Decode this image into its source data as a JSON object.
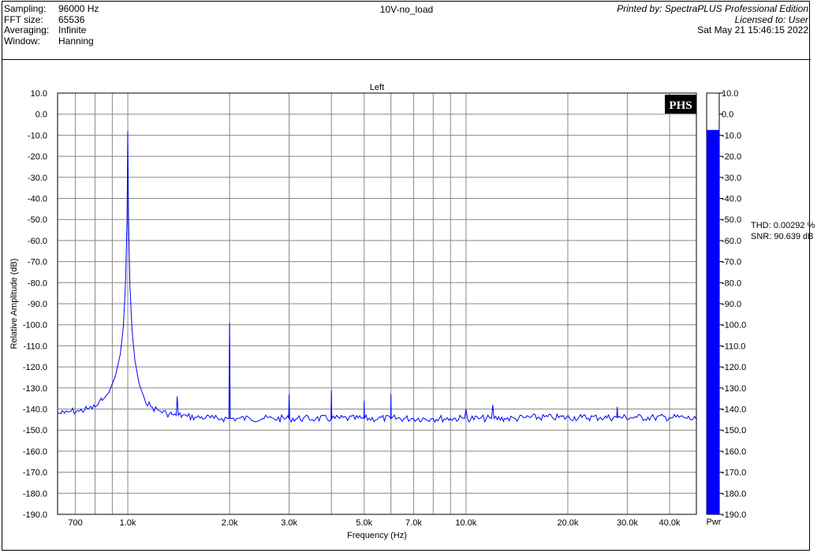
{
  "header": {
    "rows": [
      {
        "label": "Sampling:",
        "value": "96000 Hz"
      },
      {
        "label": "FFT size:",
        "value": "65536"
      },
      {
        "label": "Averaging:",
        "value": "Infinite"
      },
      {
        "label": "Window:",
        "value": "Hanning"
      }
    ],
    "title": "10V-no_load",
    "printed_by": "Printed by: SpectraPLUS Professional Edition",
    "licensed_to": "Licensed to: User",
    "date": "Sat May 21 15:46:15 2022"
  },
  "stats": {
    "thd": "THD: 0.00292 %",
    "snr": "SNR: 90.639 dB"
  },
  "logo": "PHS",
  "power_bar": {
    "label": "Pwr",
    "level_db": -7.5,
    "fill_color": "#0000ff"
  },
  "chart_data": {
    "type": "line",
    "title": "Left",
    "xlabel": "Frequency (Hz)",
    "ylabel": "Relative Amplitude (dB)",
    "x_scale": "log",
    "xlim": [
      620,
      48000
    ],
    "ylim": [
      -190,
      10
    ],
    "grid": true,
    "line_color": "#0000ff",
    "x_ticks": [
      {
        "v": 700,
        "label": "700"
      },
      {
        "v": 1000,
        "label": "1.0k"
      },
      {
        "v": 2000,
        "label": "2.0k"
      },
      {
        "v": 3000,
        "label": "3.0k"
      },
      {
        "v": 5000,
        "label": "5.0k"
      },
      {
        "v": 7000,
        "label": "7.0k"
      },
      {
        "v": 10000,
        "label": "10.0k"
      },
      {
        "v": 20000,
        "label": "20.0k"
      },
      {
        "v": 30000,
        "label": "30.0k"
      },
      {
        "v": 40000,
        "label": "40.0k"
      }
    ],
    "x_grid": [
      700,
      800,
      900,
      1000,
      2000,
      3000,
      4000,
      5000,
      6000,
      7000,
      8000,
      9000,
      10000,
      20000,
      30000,
      40000
    ],
    "y_ticks": [
      10,
      0,
      -10,
      -20,
      -30,
      -40,
      -50,
      -60,
      -70,
      -80,
      -90,
      -100,
      -110,
      -120,
      -130,
      -140,
      -150,
      -160,
      -170,
      -180,
      -190
    ],
    "y_tick_labels": [
      "10.0",
      "0.0",
      "-10.0",
      "-20.0",
      "-30.0",
      "-40.0",
      "-50.0",
      "-60.0",
      "-70.0",
      "-80.0",
      "-90.0",
      "-100.0",
      "-110.0",
      "-120.0",
      "-130.0",
      "-140.0",
      "-150.0",
      "-160.0",
      "-170.0",
      "-180.0",
      "-190.0"
    ],
    "series": [
      {
        "x": [
          620,
          650,
          680,
          720,
          760,
          800,
          840,
          880,
          920,
          950,
          970,
          985,
          995,
          1000,
          1005,
          1015,
          1030,
          1050,
          1080,
          1120,
          1170,
          1250,
          1300,
          1350,
          1390,
          1400,
          1410,
          1450,
          1500,
          1600,
          1700,
          1800,
          1900,
          1990,
          2000,
          2010,
          2100,
          2300,
          2500,
          2700,
          2990,
          3000,
          3010,
          3300,
          3600,
          3990,
          4000,
          4010,
          4500,
          4990,
          5000,
          5010,
          5500,
          5990,
          6000,
          6010,
          7000,
          8000,
          9000,
          9900,
          10000,
          10100,
          11000,
          11900,
          12000,
          12100,
          13000,
          14000,
          15000,
          18000,
          22000,
          25000,
          27900,
          28000,
          28100,
          32000,
          36000,
          40000,
          44000,
          48000
        ],
        "y": [
          -142,
          -142,
          -141,
          -141,
          -140,
          -139,
          -136,
          -132,
          -124,
          -114,
          -101,
          -80,
          -50,
          -8,
          -50,
          -82,
          -103,
          -117,
          -128,
          -135,
          -139,
          -141,
          -142,
          -142.5,
          -143,
          -134,
          -143,
          -143,
          -143.5,
          -144,
          -144,
          -144.5,
          -144.5,
          -144.5,
          -99,
          -144.5,
          -144.5,
          -144.5,
          -144.5,
          -144.5,
          -144.5,
          -133,
          -144.5,
          -144.5,
          -144.5,
          -144.5,
          -131,
          -144.5,
          -144.5,
          -144.5,
          -136,
          -144.5,
          -144.5,
          -144.5,
          -133,
          -144.5,
          -144.5,
          -144.5,
          -144.5,
          -144.5,
          -140,
          -144.5,
          -144.5,
          -144.5,
          -138,
          -144.5,
          -144.5,
          -144.5,
          -144,
          -144,
          -144,
          -144,
          -144,
          -139,
          -144,
          -144,
          -144,
          -144,
          -144,
          -145
        ]
      }
    ]
  }
}
